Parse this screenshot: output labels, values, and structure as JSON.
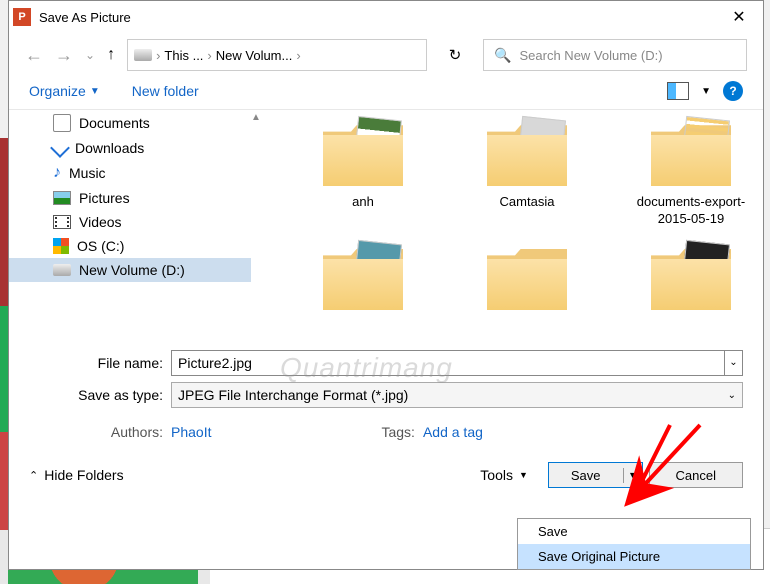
{
  "title": "Save As Picture",
  "breadcrumb": {
    "p1": "This ...",
    "p2": "New Volum..."
  },
  "search": {
    "placeholder": "Search New Volume (D:)"
  },
  "toolbar": {
    "organize": "Organize",
    "new_folder": "New folder"
  },
  "sidebar": {
    "items": [
      {
        "label": "Documents"
      },
      {
        "label": "Downloads"
      },
      {
        "label": "Music"
      },
      {
        "label": "Pictures"
      },
      {
        "label": "Videos"
      },
      {
        "label": "OS (C:)"
      },
      {
        "label": "New Volume (D:)"
      }
    ]
  },
  "folders": [
    {
      "name": "anh"
    },
    {
      "name": "Camtasia"
    },
    {
      "name": "documents-export-2015-05-19"
    }
  ],
  "form": {
    "filename_label": "File name:",
    "filename": "Picture2.jpg",
    "type_label": "Save as type:",
    "type": "JPEG File Interchange Format (*.jpg)",
    "authors_label": "Authors:",
    "authors": "PhaoIt",
    "tags_label": "Tags:",
    "tags": "Add a tag"
  },
  "buttons": {
    "hide_folders": "Hide Folders",
    "tools": "Tools",
    "save": "Save",
    "cancel": "Cancel"
  },
  "dropdown": {
    "opt1": "Save",
    "opt2": "Save Original Picture"
  },
  "watermark": "Quantrimang"
}
